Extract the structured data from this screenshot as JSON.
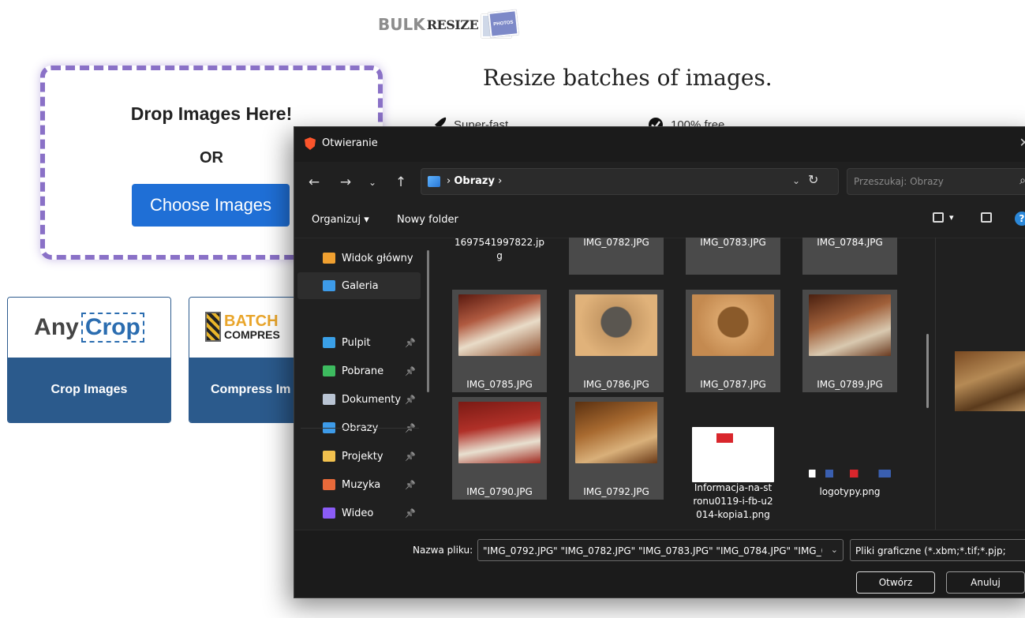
{
  "site": {
    "logo": {
      "part1": "BULK",
      "part2": "RESIZE",
      "badge": "PHOTOS"
    },
    "dropzone": {
      "title": "Drop Images Here!",
      "or": "OR",
      "button": "Choose Images"
    },
    "tagline": "Resize batches of images.",
    "features": [
      {
        "icon": "rocket-icon",
        "label": "Super-fast"
      },
      {
        "icon": "check-badge-icon",
        "label": "100% free"
      }
    ],
    "tools": [
      {
        "logo_a": "Any",
        "logo_b": "Crop",
        "label": "Crop Images"
      },
      {
        "logo_a": "BATCH",
        "logo_b": "COMPRES",
        "label": "Compress Im"
      }
    ]
  },
  "dialog": {
    "title": "Otwieranie",
    "breadcrumb": "Obrazy",
    "search_placeholder": "Przeszukaj: Obrazy",
    "commands": {
      "organize": "Organizuj",
      "new_folder": "Nowy folder"
    },
    "nav": [
      {
        "label": "Widok główny",
        "icon": "home-icon",
        "color": "#f0a030",
        "pinned": false,
        "selected": false
      },
      {
        "label": "Galeria",
        "icon": "gallery-icon",
        "color": "#3d9be9",
        "pinned": false,
        "selected": true
      },
      {
        "label": "Pulpit",
        "icon": "desktop-icon",
        "color": "#3aa0e8",
        "pinned": true,
        "selected": false
      },
      {
        "label": "Pobrane",
        "icon": "download-icon",
        "color": "#3dbb5f",
        "pinned": true,
        "selected": false
      },
      {
        "label": "Dokumenty",
        "icon": "documents-icon",
        "color": "#b9c4d3",
        "pinned": true,
        "selected": false
      },
      {
        "label": "Obrazy",
        "icon": "pictures-icon",
        "color": "#3d9be9",
        "pinned": true,
        "selected": false
      },
      {
        "label": "Projekty",
        "icon": "folder-icon",
        "color": "#f2c14e",
        "pinned": true,
        "selected": false
      },
      {
        "label": "Muzyka",
        "icon": "music-icon",
        "color": "#e86a3a",
        "pinned": true,
        "selected": false
      },
      {
        "label": "Wideo",
        "icon": "video-icon",
        "color": "#8b5cf6",
        "pinned": true,
        "selected": false
      }
    ],
    "files": [
      {
        "name": "1697541997822.jpg",
        "name_wrapped": "1697541997822.jp\ng",
        "selected": false
      },
      {
        "name": "IMG_0782.JPG",
        "selected": true
      },
      {
        "name": "IMG_0783.JPG",
        "selected": true
      },
      {
        "name": "IMG_0784.JPG",
        "selected": true
      },
      {
        "name": "IMG_0785.JPG",
        "selected": true
      },
      {
        "name": "IMG_0786.JPG",
        "selected": true
      },
      {
        "name": "IMG_0787.JPG",
        "selected": true
      },
      {
        "name": "IMG_0789.JPG",
        "selected": true
      },
      {
        "name": "IMG_0790.JPG",
        "selected": true
      },
      {
        "name": "IMG_0792.JPG",
        "selected": true
      },
      {
        "name": "Informacja-na-stronu0119-i-fb-u2014-kopia1.png",
        "name_wrapped": "Informacja-na-st\nronu0119-i-fb-u2\n014-kopia1.png",
        "selected": false
      },
      {
        "name": "logotypy.png",
        "selected": false
      }
    ],
    "filename_label": "Nazwa pliku:",
    "filename_value": "\"IMG_0792.JPG\" \"IMG_0782.JPG\" \"IMG_0783.JPG\" \"IMG_0784.JPG\" \"IMG_0",
    "filetype_value": "Pliki graficzne (*.xbm;*.tif;*.pjp;",
    "open_button": "Otwórz",
    "cancel_button": "Anuluj"
  }
}
